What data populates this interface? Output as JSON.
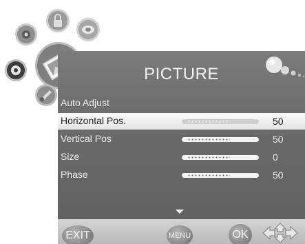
{
  "menu": {
    "title": "PICTURE",
    "items": [
      {
        "label": "Auto Adjust",
        "value": "",
        "has_slider": false
      },
      {
        "label": "Horizontal Pos.",
        "value": "50",
        "has_slider": true,
        "selected": true
      },
      {
        "label": "Vertical Pos",
        "value": "50",
        "has_slider": true
      },
      {
        "label": "Size",
        "value": "0",
        "has_slider": true
      },
      {
        "label": "Phase",
        "value": "50",
        "has_slider": true
      }
    ]
  },
  "footer": {
    "exit_label": "EXIT",
    "menu_label": "MENU",
    "ok_label": "OK"
  },
  "icons": {
    "bubbles": [
      "gear-icon",
      "lock-icon",
      "sound-icon",
      "color-icon",
      "picture-icon",
      "settings-icon"
    ],
    "title_icon": "bubbles-icon",
    "nav": "arrows-icon"
  },
  "colors": {
    "panel": "#6a6a6a",
    "selected_row": "#f0f0f0",
    "bottom_bar": "#c4c4c4"
  }
}
